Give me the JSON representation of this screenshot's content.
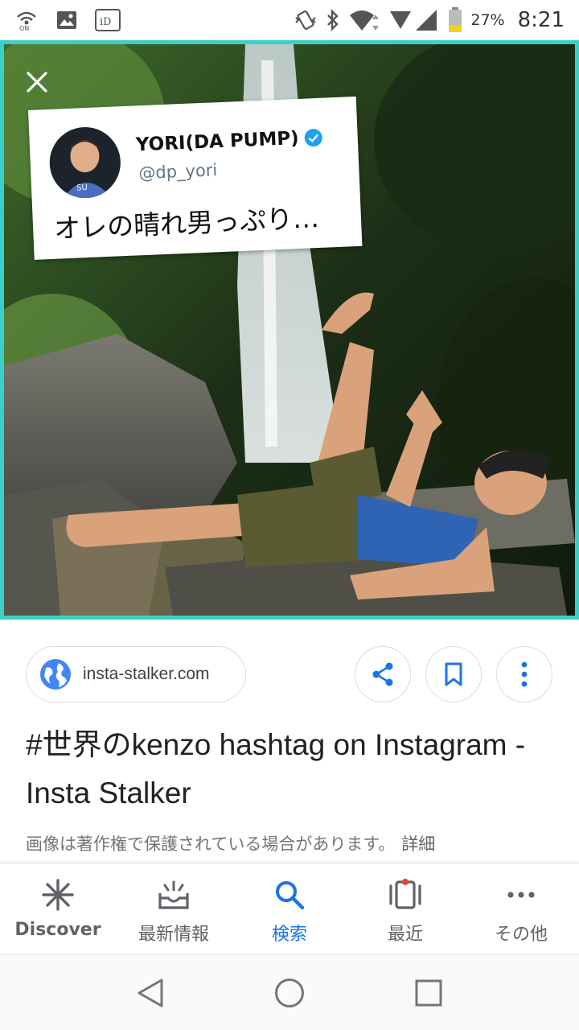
{
  "status_bar": {
    "battery_percent": "27%",
    "time": "8:21"
  },
  "viewer": {
    "tweet": {
      "name": "YORI(DA PUMP)",
      "handle": "@dp_yori",
      "text": "オレの晴れ男っぷり…"
    }
  },
  "result": {
    "source": "insta-stalker.com",
    "title": "#世界のkenzo hashtag on Instagram - Insta Stalker",
    "copyright_notice": "画像は著作権で保護されている場合があります。",
    "details_link": "詳細"
  },
  "bottom_nav": {
    "items": [
      {
        "label": "Discover",
        "icon": "asterisk-icon"
      },
      {
        "label": "最新情報",
        "icon": "updates-tray-icon"
      },
      {
        "label": "検索",
        "icon": "search-icon"
      },
      {
        "label": "最近",
        "icon": "recent-cards-icon"
      },
      {
        "label": "その他",
        "icon": "more-horizontal-icon"
      }
    ],
    "active_index": 2
  },
  "colors": {
    "accent": "#1a73e8",
    "viewer_border": "#3ccfc8",
    "twitter_blue": "#1da1f2"
  }
}
